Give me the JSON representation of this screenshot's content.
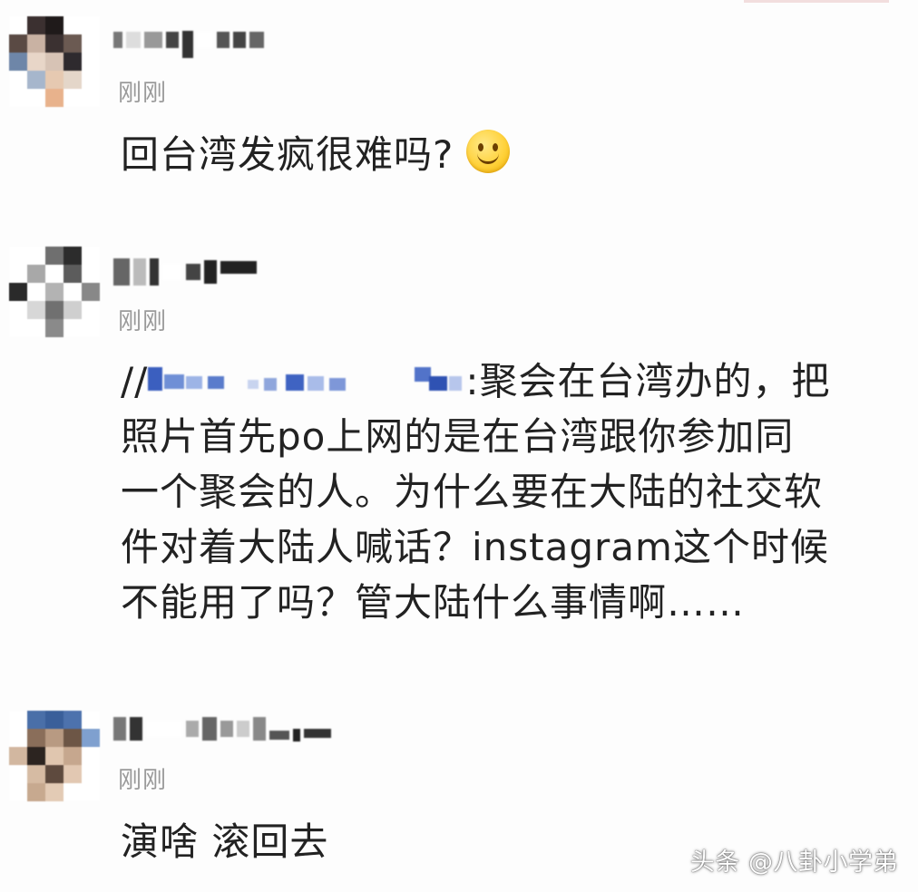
{
  "comments": [
    {
      "time": "刚刚",
      "text": "回台湾发疯很难吗?"
    },
    {
      "time": "刚刚",
      "mention_prefix": "//",
      "line1_rest": ":聚会在台湾办的，把",
      "line2": "照片首先po上网的是在台湾跟你参加同",
      "line3": "一个聚会的人。为什么要在大陆的社交软",
      "line4": "件对着大陆人喊话？instagram这个时候",
      "line5": "不能用了吗？管大陆什么事情啊……"
    },
    {
      "time": "刚刚",
      "text": "演啥 滚回去"
    }
  ],
  "watermark": "头条 @八卦小学弟",
  "icons": {
    "smile": "smiley-face-emoji"
  }
}
